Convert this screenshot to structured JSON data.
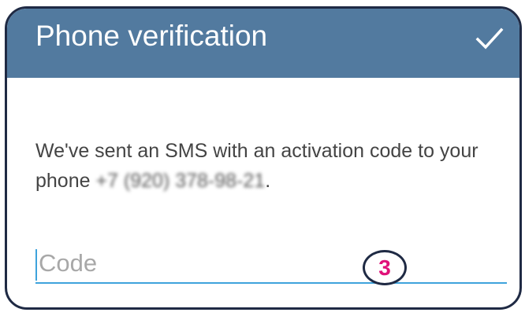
{
  "header": {
    "title": "Phone verification",
    "confirm_icon": "check-icon"
  },
  "message": {
    "text": "We've sent an SMS with an activation code to your phone ",
    "phone_number": "+7 (920) 378-98-21",
    "suffix": "."
  },
  "code_field": {
    "placeholder": "Code",
    "value": ""
  },
  "annotation": {
    "step": "3",
    "color": "#e0127a"
  },
  "colors": {
    "header_bg": "#527a9f",
    "accent": "#3ea3dc"
  }
}
